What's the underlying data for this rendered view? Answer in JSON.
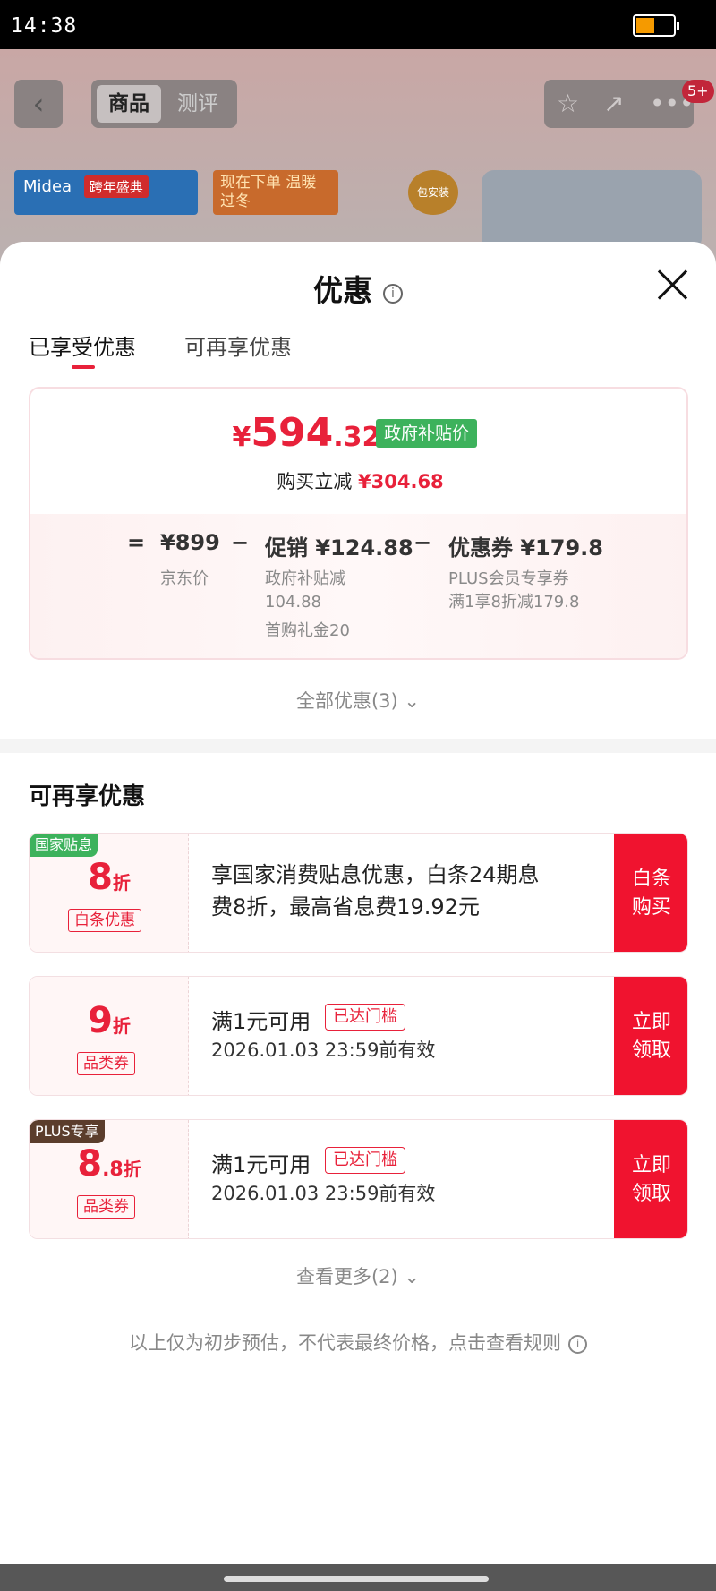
{
  "status_bar": {
    "time": "14:38"
  },
  "background_page": {
    "tabs": [
      "商品",
      "测评"
    ],
    "badge": "5+",
    "banner_brand": "Midea",
    "banner_event": "跨年盛典",
    "banner_promo": "现在下单 温暖过冬",
    "banner_badge": "包安装"
  },
  "sheet": {
    "title": "优惠",
    "tabs": [
      "已享受优惠",
      "可再享优惠"
    ],
    "summary": {
      "currency": "¥",
      "price_int": "594",
      "price_dec": ".32",
      "price_tag": "政府补贴价",
      "reduce_label": "购买立减",
      "reduce_amount": "¥304.68",
      "eq": "=",
      "minus": "−",
      "jd_price": "¥899",
      "jd_price_label": "京东价",
      "promo": "促销 ¥124.88",
      "promo_detail_1": "政府补贴减",
      "promo_detail_2": "104.88",
      "promo_detail_3": "首购礼金20",
      "coupon": "优惠券 ¥179.8",
      "coupon_detail_1": "PLUS会员专享券",
      "coupon_detail_2": "满1享8折减179.8"
    },
    "all_offers": "全部优惠(3) ⌄",
    "more_section_title": "可再享优惠",
    "coupons": [
      {
        "corner": "国家贴息",
        "num": "8",
        "dec": "",
        "unit": "折",
        "tag": "白条优惠",
        "text": "享国家消费贴息优惠，白条24期息费8折，最高省息费19.92元",
        "button": "白条购买"
      },
      {
        "corner": "",
        "num": "9",
        "dec": "",
        "unit": "折",
        "tag": "品类券",
        "line1": "满1元可用",
        "reached": "已达门槛",
        "valid": "2026.01.03 23:59前有效",
        "button": "立即领取"
      },
      {
        "corner": "PLUS专享",
        "num": "8",
        "dec": ".8",
        "unit": "折",
        "tag": "品类券",
        "line1": "满1元可用",
        "reached": "已达门槛",
        "valid": "2026.01.03 23:59前有效",
        "button": "立即领取"
      }
    ],
    "see_more": "查看更多(2) ⌄",
    "footer": "以上仅为初步预估，不代表最终价格，点击查看规则"
  },
  "colors": {
    "accent": "#e8213a",
    "gov_green": "#3db25c",
    "button_red": "#f0132f"
  }
}
